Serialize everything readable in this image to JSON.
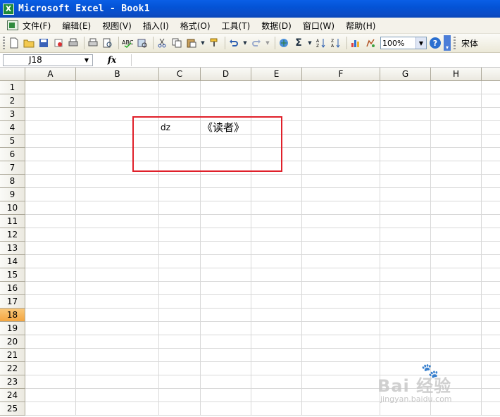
{
  "window": {
    "title": "Microsoft Excel - Book1",
    "app_icon_glyph": "X"
  },
  "menubar": {
    "items": [
      "文件(F)",
      "编辑(E)",
      "视图(V)",
      "插入(I)",
      "格式(O)",
      "工具(T)",
      "数据(D)",
      "窗口(W)",
      "帮助(H)"
    ]
  },
  "toolbar": {
    "zoom": "100%",
    "font_name": "宋体",
    "help_glyph": "?",
    "icons": [
      "new-icon",
      "open-icon",
      "save-icon",
      "permission-icon",
      "print-icon",
      "print-preview-icon",
      "spell-icon",
      "research-icon",
      "cut-icon",
      "copy-icon",
      "paste-icon",
      "format-painter-icon",
      "undo-icon",
      "redo-icon",
      "hyperlink-icon",
      "autosum-icon",
      "sort-asc-icon",
      "sort-desc-icon",
      "chart-wizard-icon",
      "drawing-icon"
    ]
  },
  "formulabar": {
    "cell_ref": "J18",
    "fx_label": "fx",
    "content": ""
  },
  "sheet": {
    "columns": [
      "A",
      "B",
      "C",
      "D",
      "E",
      "F",
      "G",
      "H"
    ],
    "rows": [
      "1",
      "2",
      "3",
      "4",
      "5",
      "6",
      "7",
      "8",
      "9",
      "10",
      "11",
      "12",
      "13",
      "14",
      "15",
      "16",
      "17",
      "18",
      "19",
      "20",
      "21",
      "22",
      "23",
      "24",
      "25"
    ],
    "active_row": "18",
    "cells": {
      "C4": "dz",
      "D4": "《读者》"
    }
  },
  "watermark": {
    "main": "Bai 经验",
    "sub": "jingyan.baidu.com"
  },
  "colors": {
    "highlight": "#e0202a",
    "active_row_header": "#f4a640",
    "titlebar": "#0453d6"
  }
}
